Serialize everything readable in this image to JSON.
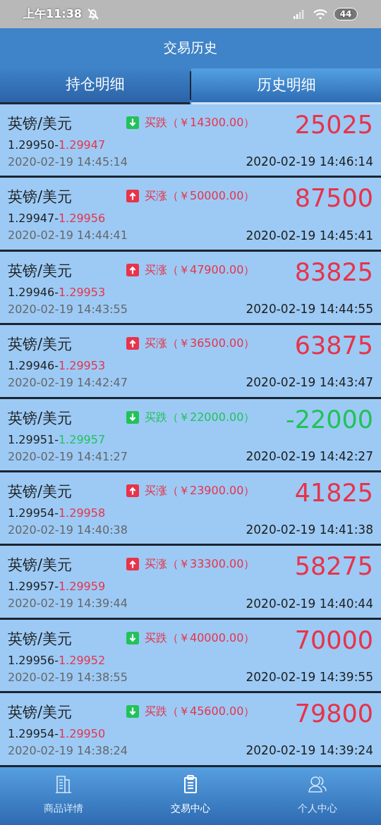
{
  "status_bar": {
    "time": "上午11:38",
    "battery": "44"
  },
  "header": {
    "title": "交易历史"
  },
  "tabs": [
    {
      "label": "持仓明细",
      "selected": false
    },
    {
      "label": "历史明细",
      "selected": true
    }
  ],
  "trades": [
    {
      "symbol": "英镑/美元",
      "kind": "down",
      "order": "买跌（￥14300.00）",
      "open_price": "1.29950-",
      "close_price": "1.29947",
      "color": "#e8334a",
      "result": "25025",
      "open_time": "2020-02-19 14:45:14",
      "close_time": "2020-02-19 14:46:14"
    },
    {
      "symbol": "英镑/美元",
      "kind": "up",
      "order": "买涨（￥50000.00）",
      "open_price": "1.29947-",
      "close_price": "1.29956",
      "color": "#e8334a",
      "result": "87500",
      "open_time": "2020-02-19 14:44:41",
      "close_time": "2020-02-19 14:45:41"
    },
    {
      "symbol": "英镑/美元",
      "kind": "up",
      "order": "买涨（￥47900.00）",
      "open_price": "1.29946-",
      "close_price": "1.29953",
      "color": "#e8334a",
      "result": "83825",
      "open_time": "2020-02-19 14:43:55",
      "close_time": "2020-02-19 14:44:55"
    },
    {
      "symbol": "英镑/美元",
      "kind": "up",
      "order": "买涨（￥36500.00）",
      "open_price": "1.29946-",
      "close_price": "1.29953",
      "color": "#e8334a",
      "result": "63875",
      "open_time": "2020-02-19 14:42:47",
      "close_time": "2020-02-19 14:43:47"
    },
    {
      "symbol": "英镑/美元",
      "kind": "down",
      "order": "买跌（￥22000.00）",
      "open_price": "1.29951-",
      "close_price": "1.29957",
      "color": "#22c25a",
      "result": "-22000",
      "open_time": "2020-02-19 14:41:27",
      "close_time": "2020-02-19 14:42:27"
    },
    {
      "symbol": "英镑/美元",
      "kind": "up",
      "order": "买涨（￥23900.00）",
      "open_price": "1.29954-",
      "close_price": "1.29958",
      "color": "#e8334a",
      "result": "41825",
      "open_time": "2020-02-19 14:40:38",
      "close_time": "2020-02-19 14:41:38"
    },
    {
      "symbol": "英镑/美元",
      "kind": "up",
      "order": "买涨（￥33300.00）",
      "open_price": "1.29957-",
      "close_price": "1.29959",
      "color": "#e8334a",
      "result": "58275",
      "open_time": "2020-02-19 14:39:44",
      "close_time": "2020-02-19 14:40:44"
    },
    {
      "symbol": "英镑/美元",
      "kind": "down",
      "order": "买跌（￥40000.00）",
      "open_price": "1.29956-",
      "close_price": "1.29952",
      "color": "#e8334a",
      "result": "70000",
      "open_time": "2020-02-19 14:38:55",
      "close_time": "2020-02-19 14:39:55"
    },
    {
      "symbol": "英镑/美元",
      "kind": "down",
      "order": "买跌（￥45600.00）",
      "open_price": "1.29954-",
      "close_price": "1.29950",
      "color": "#e8334a",
      "result": "79800",
      "open_time": "2020-02-19 14:38:24",
      "close_time": "2020-02-19 14:39:24"
    }
  ],
  "bottom_nav": [
    {
      "kind": "building",
      "label": "商品详情",
      "selected": false
    },
    {
      "kind": "clipboard",
      "label": "交易中心",
      "selected": true
    },
    {
      "kind": "people",
      "label": "个人中心",
      "selected": false
    }
  ]
}
